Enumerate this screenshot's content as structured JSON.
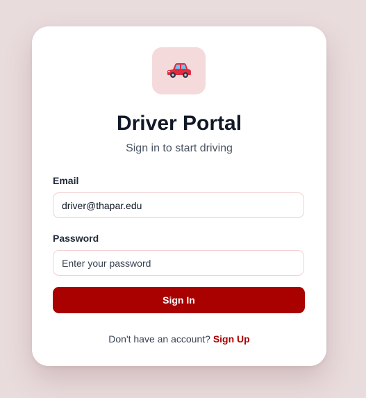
{
  "app": {
    "icon": "car-icon",
    "title": "Driver Portal",
    "subtitle": "Sign in to start driving"
  },
  "form": {
    "email_label": "Email",
    "email_value": "driver@thapar.edu",
    "password_label": "Password",
    "password_placeholder": "Enter your password",
    "submit_label": "Sign In"
  },
  "footer": {
    "prompt": "Don't have an account?",
    "signup_link": "Sign Up"
  },
  "colors": {
    "accent": "#a90000",
    "page_background": "#e9dcdd",
    "logo_background": "#f5dadc",
    "input_border": "#f3cfd2"
  }
}
